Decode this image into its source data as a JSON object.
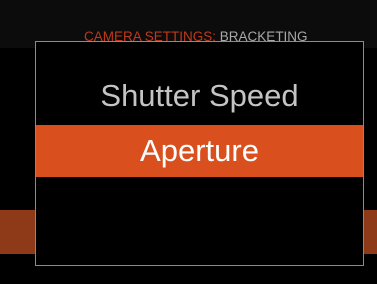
{
  "header": {
    "section": "CAMERA SETTINGS:",
    "page": "BRACKETING"
  },
  "colors": {
    "accent": "#d9501e",
    "header_section": "#c0381a",
    "header_page": "#a8a8a8",
    "option_text": "#c4c4c4",
    "selected_text": "#ffffff",
    "background": "#000000",
    "dialog_border": "#8a8a8a"
  },
  "popup": {
    "options": [
      {
        "label": "Shutter Speed",
        "selected": false
      },
      {
        "label": "Aperture",
        "selected": true
      }
    ]
  }
}
